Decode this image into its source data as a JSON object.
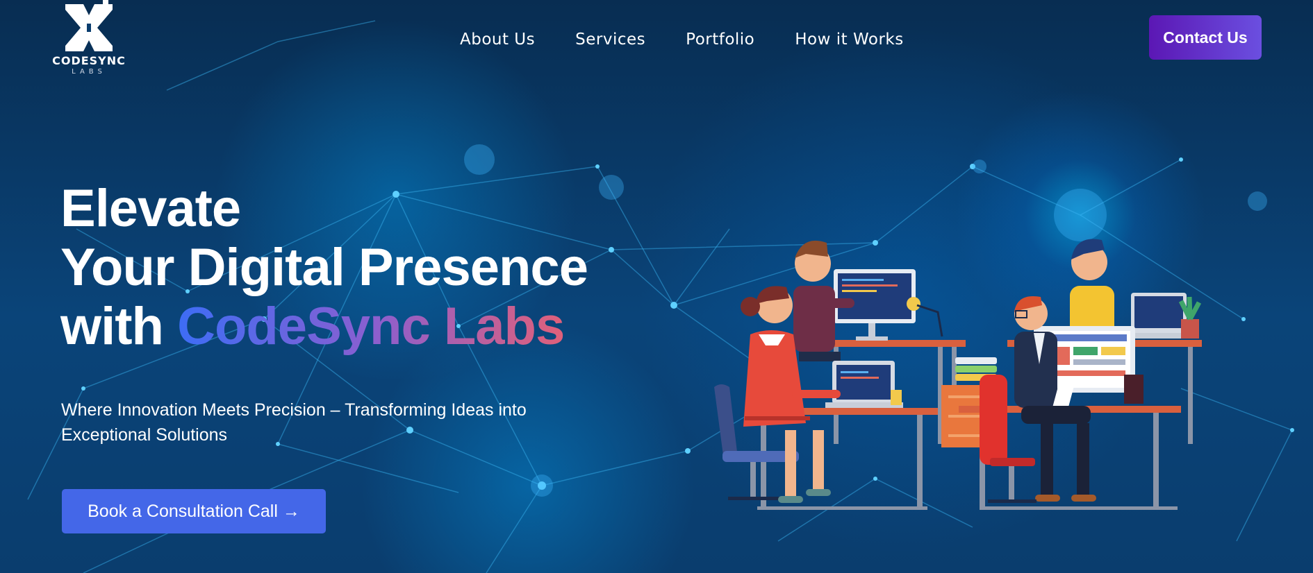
{
  "logo": {
    "name": "CODESYNC",
    "sub": "LABS"
  },
  "nav": {
    "items": [
      "About Us",
      "Services",
      "Portfolio",
      "How it Works"
    ],
    "contact_label": "Contact Us"
  },
  "hero": {
    "line1": "Elevate",
    "line2": "Your Digital Presence",
    "line3_prefix": "with ",
    "line3_highlight": "CodeSync Labs",
    "subtitle": "Where Innovation Meets Precision – Transforming Ideas into Exceptional Solutions",
    "cta_label": "Book a Consultation Call",
    "cta_icon": "→"
  },
  "colors": {
    "background": "#0a3d6e",
    "cta": "#4467e8",
    "contact_start": "#5b17b4",
    "contact_end": "#6b4fe0",
    "highlight_start": "#3d6df5",
    "highlight_end": "#e0607a"
  },
  "icons": [
    "codesync-logo-icon",
    "arrow-right-icon",
    "network-background",
    "developers-illustration"
  ]
}
